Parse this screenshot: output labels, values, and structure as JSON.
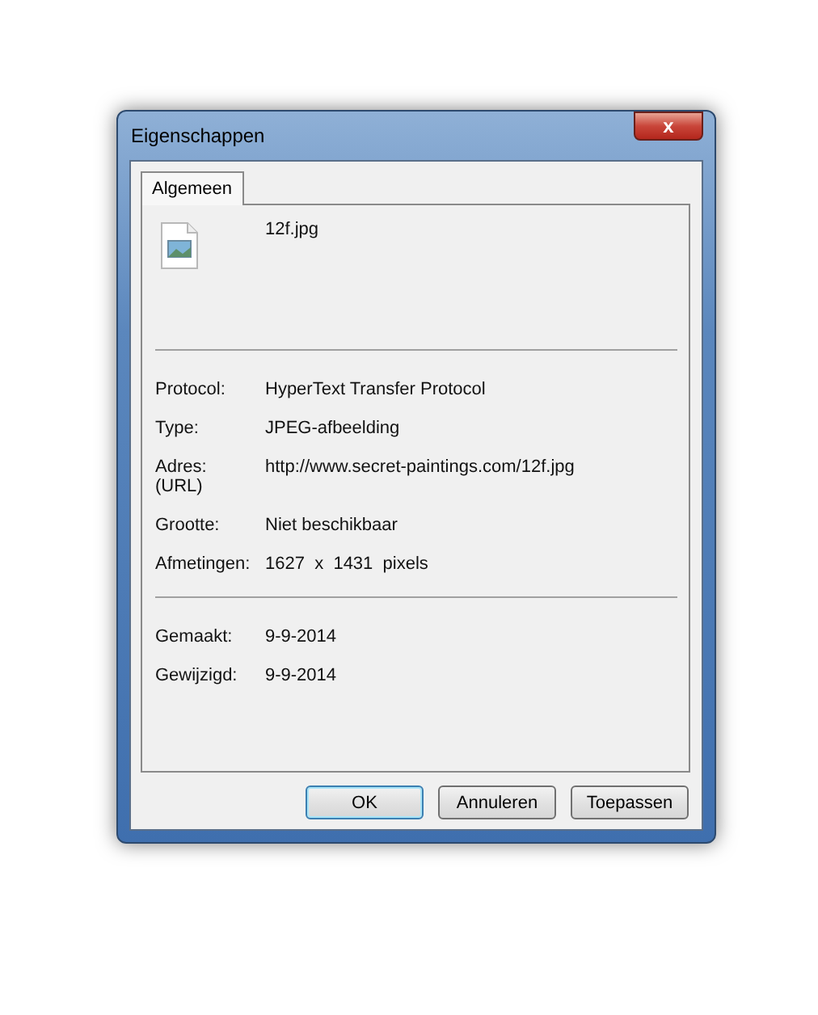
{
  "window": {
    "title": "Eigenschappen",
    "close": "x"
  },
  "tabs": [
    {
      "label": "Algemeen",
      "selected": true
    }
  ],
  "file": {
    "name": "12f.jpg"
  },
  "sections": [
    {
      "rows": [
        {
          "label": "Protocol:",
          "value": "HyperText Transfer Protocol"
        },
        {
          "label": "Type:",
          "value": "JPEG-afbeelding"
        },
        {
          "label": "Adres:\n(URL)",
          "value": "http://www.secret-paintings.com/12f.jpg"
        },
        {
          "label": "Grootte:",
          "value": "Niet beschikbaar"
        },
        {
          "label": "Afmetingen:",
          "value": "1627  x  1431  pixels"
        }
      ]
    },
    {
      "rows": [
        {
          "label": "Gemaakt:",
          "value": "9-9-2014"
        },
        {
          "label": "Gewijzigd:",
          "value": "9-9-2014"
        }
      ]
    }
  ],
  "buttons": [
    {
      "label": "OK",
      "kind": "default"
    },
    {
      "label": "Annuleren",
      "kind": "normal"
    },
    {
      "label": "Toepassen",
      "kind": "normal"
    }
  ]
}
